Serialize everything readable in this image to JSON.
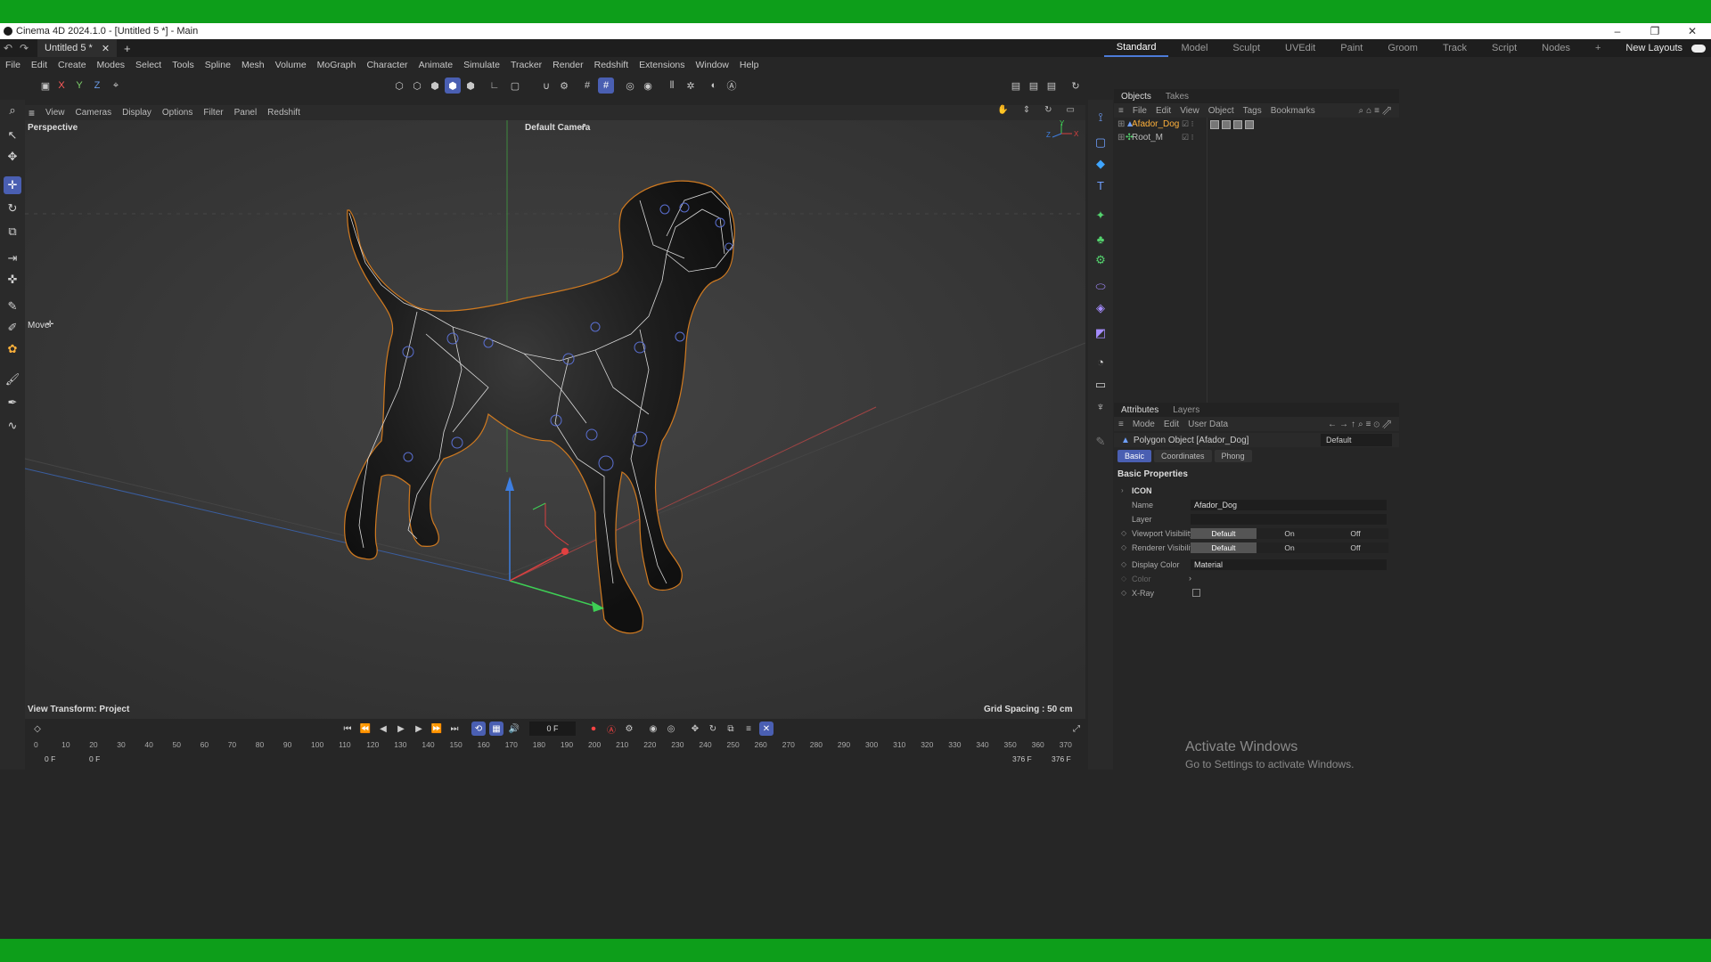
{
  "window": {
    "title": "Cinema 4D 2024.1.0 - [Untitled 5 *] - Main",
    "document_tab": "Untitled 5 *"
  },
  "layouts": {
    "items": [
      "Standard",
      "Model",
      "Sculpt",
      "UVEdit",
      "Paint",
      "Groom",
      "Track",
      "Script",
      "Nodes"
    ],
    "active": "Standard",
    "new_layouts": "New Layouts"
  },
  "menu": [
    "File",
    "Edit",
    "Create",
    "Modes",
    "Select",
    "Tools",
    "Spline",
    "Mesh",
    "Volume",
    "MoGraph",
    "Character",
    "Animate",
    "Simulate",
    "Tracker",
    "Render",
    "Redshift",
    "Extensions",
    "Window",
    "Help"
  ],
  "toolbar": {
    "axis_x": "X",
    "axis_y": "Y",
    "axis_z": "Z"
  },
  "viewport": {
    "menu": [
      "View",
      "Cameras",
      "Display",
      "Options",
      "Filter",
      "Panel",
      "Redshift"
    ],
    "view_name": "Perspective",
    "camera": "Default Camera",
    "tool_label": "Move",
    "view_transform": "View Transform: Project",
    "grid_spacing": "Grid Spacing : 50 cm",
    "axis_y": "Y",
    "axis_z": "Z",
    "axis_x": "X"
  },
  "objects": {
    "tabs": [
      "Objects",
      "Takes"
    ],
    "menu": [
      "File",
      "Edit",
      "View",
      "Object",
      "Tags",
      "Bookmarks"
    ],
    "items": [
      {
        "name": "Afador_Dog",
        "selected": true
      },
      {
        "name": "Root_M",
        "selected": false
      }
    ]
  },
  "attributes": {
    "tabs": [
      "Attributes",
      "Layers"
    ],
    "menu": [
      "Mode",
      "Edit",
      "User Data"
    ],
    "object_type": "Polygon Object [Afador_Dog]",
    "preset": "Default",
    "sub_tabs": [
      "Basic",
      "Coordinates",
      "Phong"
    ],
    "section": "Basic Properties",
    "group": "ICON",
    "name_label": "Name",
    "name_value": "Afador_Dog",
    "layer_label": "Layer",
    "viewport_visibility_label": "Viewport Visibility",
    "renderer_visibility_label": "Renderer Visibility",
    "visibility_options": [
      "Default",
      "On",
      "Off"
    ],
    "display_color_label": "Display Color",
    "display_color_value": "Material",
    "color_label": "Color",
    "xray_label": "X-Ray"
  },
  "timeline": {
    "current_frame": "0 F",
    "ticks": [
      "0",
      "10",
      "20",
      "30",
      "40",
      "50",
      "60",
      "70",
      "80",
      "90",
      "100",
      "110",
      "120",
      "130",
      "140",
      "150",
      "160",
      "170",
      "180",
      "190",
      "200",
      "210",
      "220",
      "230",
      "240",
      "250",
      "260",
      "270",
      "280",
      "290",
      "300",
      "310",
      "320",
      "330",
      "340",
      "350",
      "360",
      "370"
    ],
    "range_start": "0 F",
    "range_start_inner": "0 F",
    "range_end_inner": "376 F",
    "range_end": "376 F"
  },
  "watermark": {
    "line1": "Activate Windows",
    "line2": "Go to Settings to activate Windows."
  }
}
